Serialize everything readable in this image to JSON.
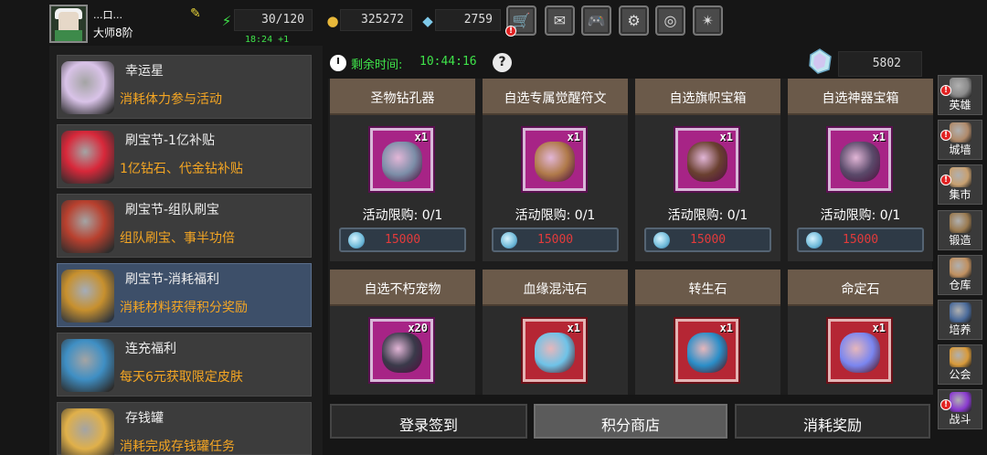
{
  "player": {
    "name": "...口...",
    "rank": "大师8阶"
  },
  "resources": {
    "stamina": "30/120",
    "stamina_regen": "18:24 +1",
    "gold": "325272",
    "diamonds": "2759"
  },
  "top_buttons": [
    {
      "name": "shop-cart-icon",
      "glyph": "🛒",
      "badge": "!"
    },
    {
      "name": "mail-icon",
      "glyph": "✉"
    },
    {
      "name": "gamepad-icon",
      "glyph": "🎮"
    },
    {
      "name": "settings-gear-icon",
      "glyph": "⚙"
    },
    {
      "name": "color-wheel-icon",
      "glyph": "◎"
    },
    {
      "name": "fireworks-icon",
      "glyph": "✴"
    }
  ],
  "events": [
    {
      "title": "幸运星",
      "desc": "消耗体力参与活动",
      "icon": "lucky-star-icon",
      "color": "#d9c3e8"
    },
    {
      "title": "刷宝节-1亿补贴",
      "desc": "1亿钻石、代金钻补贴",
      "icon": "red-flower-icon",
      "color": "#d8283a"
    },
    {
      "title": "刷宝节-组队刷宝",
      "desc": "组队刷宝、事半功倍",
      "icon": "treasure-chest-icon",
      "color": "#b8402e"
    },
    {
      "title": "刷宝节-消耗福利",
      "desc": "消耗材料获得积分奖励",
      "icon": "open-chest-icon",
      "color": "#c7902e",
      "active": true
    },
    {
      "title": "连充福利",
      "desc": "每天6元获取限定皮肤",
      "icon": "ice-crystal-icon",
      "color": "#3f8fc4"
    },
    {
      "title": "存钱罐",
      "desc": "消耗完成存钱罐任务",
      "icon": "piggy-bank-icon",
      "color": "#e0b04a"
    }
  ],
  "timer": {
    "label": "剩余时间:",
    "value": "10:44:16"
  },
  "gem_balance": "5802",
  "shop_items": [
    {
      "title": "圣物钻孔器",
      "qty": "x1",
      "limit": "活动限购: 0/1",
      "price": "15000",
      "frame": "purple",
      "art": "drill-icon",
      "art_color": "#7c8ea8"
    },
    {
      "title": "自选专属觉醒符文",
      "qty": "x1",
      "limit": "活动限购: 0/1",
      "price": "15000",
      "frame": "purple",
      "art": "rune-bag-icon",
      "art_color": "#b07a4a"
    },
    {
      "title": "自选旗帜宝箱",
      "qty": "x1",
      "limit": "活动限购: 0/1",
      "price": "15000",
      "frame": "purple",
      "art": "banner-chest-icon",
      "art_color": "#6a4030"
    },
    {
      "title": "自选神器宝箱",
      "qty": "x1",
      "limit": "活动限购: 0/1",
      "price": "15000",
      "frame": "purple",
      "art": "artifact-chest-icon",
      "art_color": "#5a4a6a"
    },
    {
      "title": "自选不朽宠物",
      "qty": "x20",
      "frame": "purple",
      "art": "pet-chest-icon",
      "art_color": "#3a3a4a"
    },
    {
      "title": "血缘混沌石",
      "qty": "x1",
      "frame": "red",
      "art": "chaos-stone-icon",
      "art_color": "#6ec3e8"
    },
    {
      "title": "转生石",
      "qty": "x1",
      "frame": "red",
      "art": "rebirth-stone-icon",
      "art_color": "#2a8ec8"
    },
    {
      "title": "命定石",
      "qty": "x1",
      "frame": "red",
      "art": "destiny-stone-icon",
      "art_color": "#7a86f0"
    }
  ],
  "tabs": [
    {
      "label": "登录签到"
    },
    {
      "label": "积分商店",
      "active": true
    },
    {
      "label": "消耗奖励"
    }
  ],
  "right_nav": [
    {
      "label": "英雄",
      "icon": "hero-helmet-icon",
      "color": "#8a8a8a",
      "badge": "!"
    },
    {
      "label": "城墙",
      "icon": "castle-wall-icon",
      "color": "#b08a6a",
      "badge": "!"
    },
    {
      "label": "集市",
      "icon": "market-icon",
      "color": "#c8a070",
      "badge": "!"
    },
    {
      "label": "锻造",
      "icon": "anvil-icon",
      "color": "#9a7a50"
    },
    {
      "label": "仓库",
      "icon": "warehouse-icon",
      "color": "#c09060"
    },
    {
      "label": "培养",
      "icon": "chalice-icon",
      "color": "#4a6a9a"
    },
    {
      "label": "公会",
      "icon": "guild-emblem-icon",
      "color": "#d89a3a"
    },
    {
      "label": "战斗",
      "icon": "battle-portal-icon",
      "color": "#8a3ad0",
      "badge": "!"
    }
  ]
}
